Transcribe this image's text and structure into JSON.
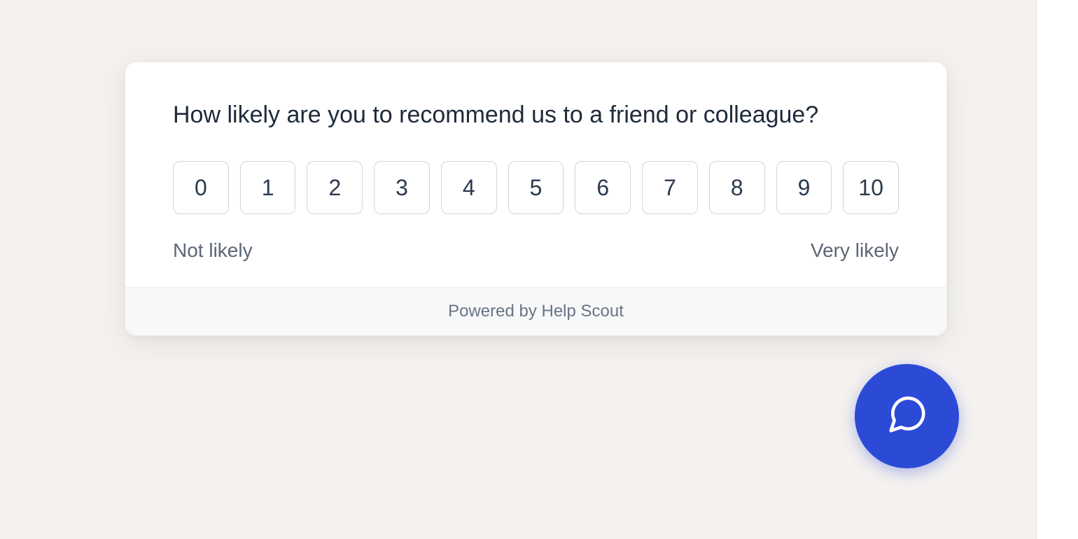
{
  "survey": {
    "question": "How likely are you to recommend us to a friend or colleague?",
    "ratings": [
      "0",
      "1",
      "2",
      "3",
      "4",
      "5",
      "6",
      "7",
      "8",
      "9",
      "10"
    ],
    "low_label": "Not likely",
    "high_label": "Very likely",
    "footer_text": "Powered by Help Scout"
  },
  "chat": {
    "icon_name": "chat-bubble-icon",
    "brand_color": "#2b4ad6"
  }
}
